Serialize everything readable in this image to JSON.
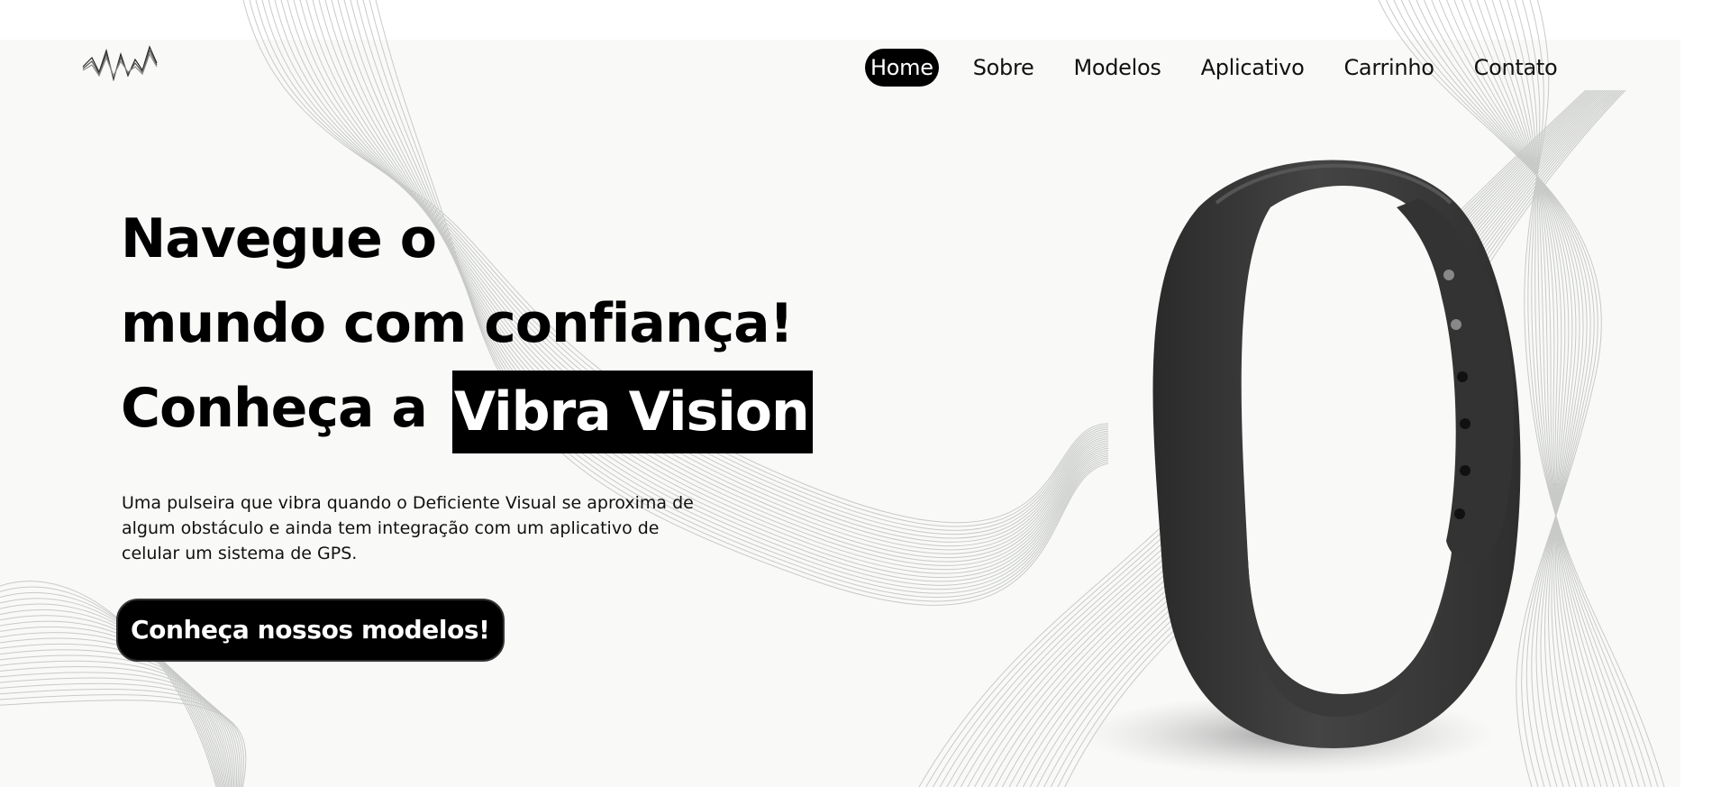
{
  "header": {
    "nav": [
      {
        "label": "Home",
        "active": true
      },
      {
        "label": "Sobre"
      },
      {
        "label": "Modelos"
      },
      {
        "label": "Aplicativo"
      },
      {
        "label": "Carrinho"
      },
      {
        "label": "Contato"
      }
    ]
  },
  "hero": {
    "headline_line1": "Navegue o",
    "headline_line2": "mundo com confiança!",
    "headline_line3": "Conheça a",
    "brand_name": "Vibra Vision",
    "description": "Uma pulseira que vibra quando o Deficiente Visual se aproxima de algum obstáculo e ainda tem integração com um aplicativo de celular um sistema de GPS.",
    "cta_label": "Conheça nossos modelos!"
  },
  "icons": {
    "logo": "sound-wave-icon",
    "product": "wristband-image"
  },
  "colors": {
    "background": "#f9faf8",
    "accent": "#000000",
    "text": "#111111",
    "wave_lines": "#c8cac8"
  }
}
